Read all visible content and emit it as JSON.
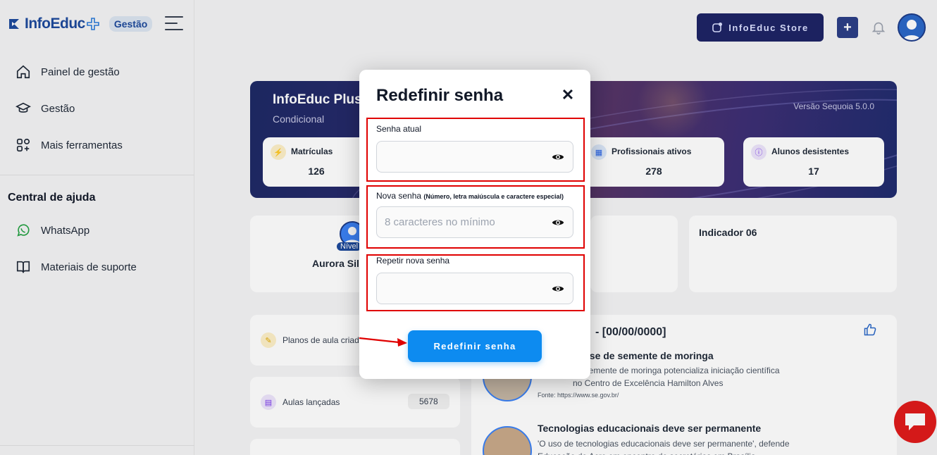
{
  "app": {
    "logo_text": "InfoEduc",
    "logo_badge": "Gestão"
  },
  "sidebar": {
    "items": [
      {
        "label": "Painel de gestão",
        "icon": "home-icon"
      },
      {
        "label": "Gestão",
        "icon": "graduation-cap-icon"
      },
      {
        "label": "Mais ferramentas",
        "icon": "grid-plus-icon"
      }
    ],
    "help_title": "Central de ajuda",
    "help_items": [
      {
        "label": "WhatsApp",
        "icon": "whatsapp-icon"
      },
      {
        "label": "Materiais de suporte",
        "icon": "book-icon"
      }
    ]
  },
  "header": {
    "store_label": "InfoEduc Store"
  },
  "banner": {
    "title": "InfoEduc Plus",
    "subtitle": "Condicional",
    "version": "Versão Sequoia 5.0.0",
    "stats": [
      {
        "label": "Matrículas",
        "value": "126"
      },
      {
        "label": "Profissionais ativos",
        "value": "278"
      },
      {
        "label": "Alunos desistentes",
        "value": "17"
      }
    ]
  },
  "profile": {
    "level": "Nível",
    "name": "Aurora Sil"
  },
  "indicator": {
    "label": "Indicador 06"
  },
  "side_cards": [
    {
      "label": "Planos de aula criad"
    },
    {
      "label": "Aulas lançadas",
      "count": "5678"
    }
  ],
  "news": {
    "header": "- [00/00/0000]",
    "items": [
      {
        "title": "ase de semente de moringa",
        "body": "de semente de moringa potencializa iniciação científica no Centro de Excelência Hamilton Alves",
        "source": "Fonte: https://www.se.gov.br/"
      },
      {
        "title": "Tecnologias educacionais deve ser permanente",
        "body": "'O uso de tecnologias educacionais deve ser permanente', defende Educação de Acre em encontro de secretários em Brasília"
      }
    ]
  },
  "modal": {
    "title": "Redefinir senha",
    "fields": [
      {
        "label": "Senha atual",
        "hint": "",
        "placeholder": ""
      },
      {
        "label": "Nova senha",
        "hint": "(Número, letra maiúscula e caractere especial)",
        "placeholder": "8 caracteres no mínimo"
      },
      {
        "label": "Repetir nova senha",
        "hint": "",
        "placeholder": ""
      }
    ],
    "submit_label": "Redefinir senha"
  },
  "colors": {
    "brand": "#1e4a9c",
    "primary_button": "#0d8bf0",
    "highlight_box": "#e00000",
    "chat_fab": "#e01b1b"
  }
}
